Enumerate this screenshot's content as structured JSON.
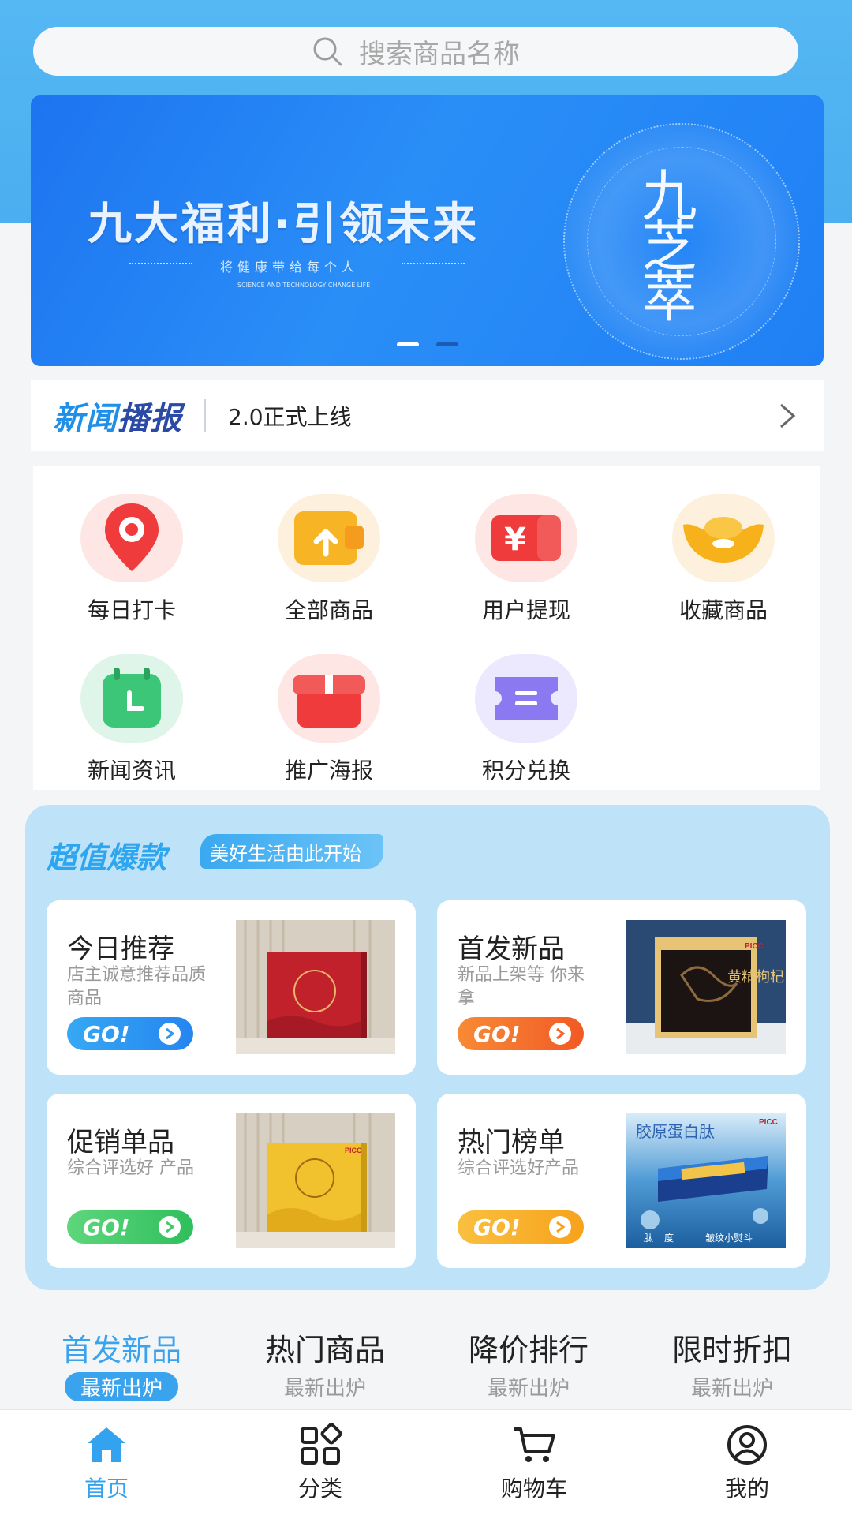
{
  "search": {
    "placeholder": "搜索商品名称"
  },
  "banner": {
    "title": "九大福利·引领未来",
    "subtitle": "将健康带给每个人",
    "subtitle_en": "SCIENCE AND TECHNOLOGY CHANGE LIFE",
    "logo_text": "九芝萃",
    "slides": 2,
    "active_slide": 0
  },
  "news": {
    "label_part1": "新闻",
    "label_part2": "播报",
    "headline": "2.0正式上线"
  },
  "grid": {
    "items": [
      {
        "label": "每日打卡",
        "icon": "map-pin-icon",
        "color": "#ef3b3b"
      },
      {
        "label": "全部商品",
        "icon": "wallet-upload-icon",
        "color": "#f5a623"
      },
      {
        "label": "用户提现",
        "icon": "yuan-card-icon",
        "color": "#ef3b3b"
      },
      {
        "label": "收藏商品",
        "icon": "gold-ingot-icon",
        "color": "#f7b21b"
      },
      {
        "label": "新闻资讯",
        "icon": "calendar-clock-icon",
        "color": "#34c67a"
      },
      {
        "label": "推广海报",
        "icon": "gift-box-icon",
        "color": "#ef3b3b"
      },
      {
        "label": "积分兑换",
        "icon": "ticket-icon",
        "color": "#8b79f2"
      }
    ]
  },
  "deals": {
    "title": "超值爆款",
    "tag": "美好生活由此开始",
    "cards": [
      {
        "title": "今日推荐",
        "desc": "店主诚意推荐品质商品",
        "go": "GO!",
        "color": "#2c9af0"
      },
      {
        "title": "首发新品",
        "desc": "新品上架等 你来拿",
        "go": "GO!",
        "color": "#f5652a"
      },
      {
        "title": "促销单品",
        "desc": "综合评选好 产品",
        "go": "GO!",
        "color": "#43c96b"
      },
      {
        "title": "热门榜单",
        "desc": "综合评选好产品",
        "go": "GO!",
        "color": "#f7a21b"
      }
    ],
    "product_texts": {
      "card2_box": "黄精枸杞",
      "card4_top": "胶原蛋白肽",
      "card4_bottom1": "肽",
      "card4_bottom2": "度",
      "card4_bottom3": "皱纹小熨斗",
      "brand": "PICC"
    }
  },
  "tabs": [
    {
      "title": "首发新品",
      "sub": "最新出炉",
      "active": true
    },
    {
      "title": "热门商品",
      "sub": "最新出炉",
      "active": false
    },
    {
      "title": "降价排行",
      "sub": "最新出炉",
      "active": false
    },
    {
      "title": "限时折扣",
      "sub": "最新出炉",
      "active": false
    }
  ],
  "nav": [
    {
      "label": "首页",
      "icon": "home-icon",
      "active": true
    },
    {
      "label": "分类",
      "icon": "grid-icon",
      "active": false
    },
    {
      "label": "购物车",
      "icon": "cart-icon",
      "active": false
    },
    {
      "label": "我的",
      "icon": "user-icon",
      "active": false
    }
  ],
  "colors": {
    "primary": "#3aa3ee",
    "deals_bg": "#bee3f8"
  }
}
